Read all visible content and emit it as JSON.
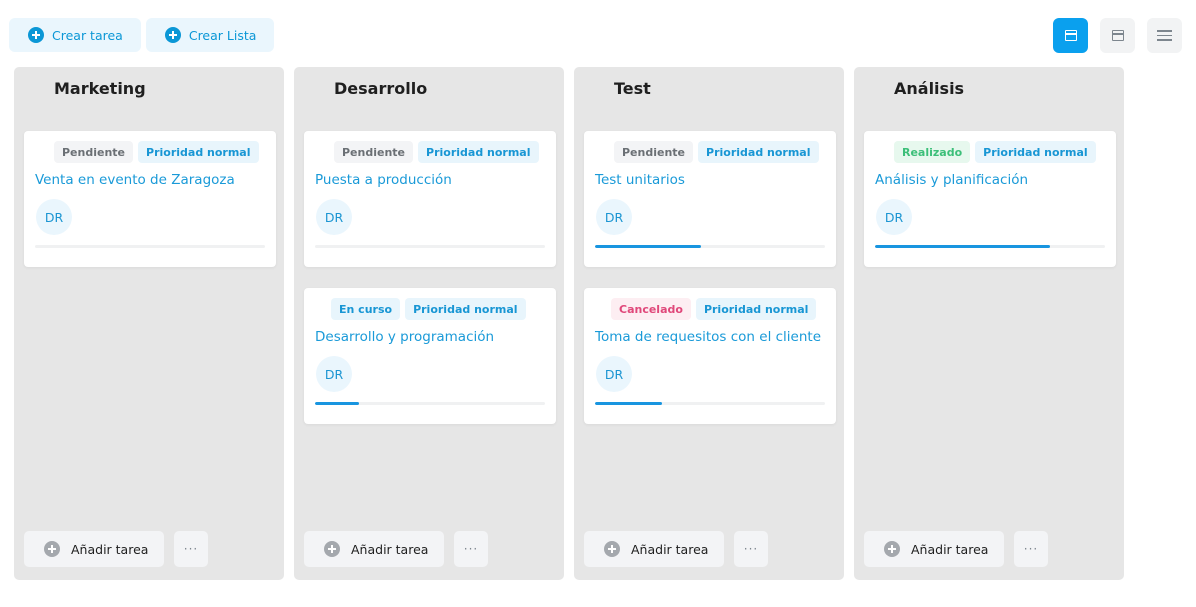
{
  "toolbar": {
    "create_task_label": "Crear tarea",
    "create_list_label": "Crear Lista",
    "accent_color": "#0aa0ee"
  },
  "views": [
    {
      "icon": "board-view-icon",
      "active": true
    },
    {
      "icon": "compact-view-icon",
      "active": false
    },
    {
      "icon": "list-view-icon",
      "active": false
    }
  ],
  "columns": [
    {
      "title": "Marketing",
      "add_label": "Añadir tarea",
      "more_label": "···",
      "cards": [
        {
          "status": "Pendiente",
          "priority": "Prioridad normal",
          "title": "Venta en evento de Zaragoza",
          "assignee": "DR",
          "progress": 0
        }
      ]
    },
    {
      "title": "Desarrollo",
      "add_label": "Añadir tarea",
      "more_label": "···",
      "cards": [
        {
          "status": "Pendiente",
          "priority": "Prioridad normal",
          "title": "Puesta a producción",
          "assignee": "DR",
          "progress": 0
        },
        {
          "status": "En curso",
          "priority": "Prioridad normal",
          "title": "Desarrollo y programación",
          "assignee": "DR",
          "progress": 0.19
        }
      ]
    },
    {
      "title": "Test",
      "add_label": "Añadir tarea",
      "more_label": "···",
      "cards": [
        {
          "status": "Pendiente",
          "priority": "Prioridad normal",
          "title": "Test unitarios",
          "assignee": "DR",
          "progress": 0.46
        },
        {
          "status": "Cancelado",
          "priority": "Prioridad normal",
          "title": "Toma de requesitos con el cliente",
          "assignee": "DR",
          "progress": 0.29
        }
      ]
    },
    {
      "title": "Análisis",
      "add_label": "Añadir tarea",
      "more_label": "···",
      "cards": [
        {
          "status": "Realizado",
          "priority": "Prioridad normal",
          "title": "Análisis y planificación",
          "assignee": "DR",
          "progress": 0.76
        }
      ]
    }
  ]
}
